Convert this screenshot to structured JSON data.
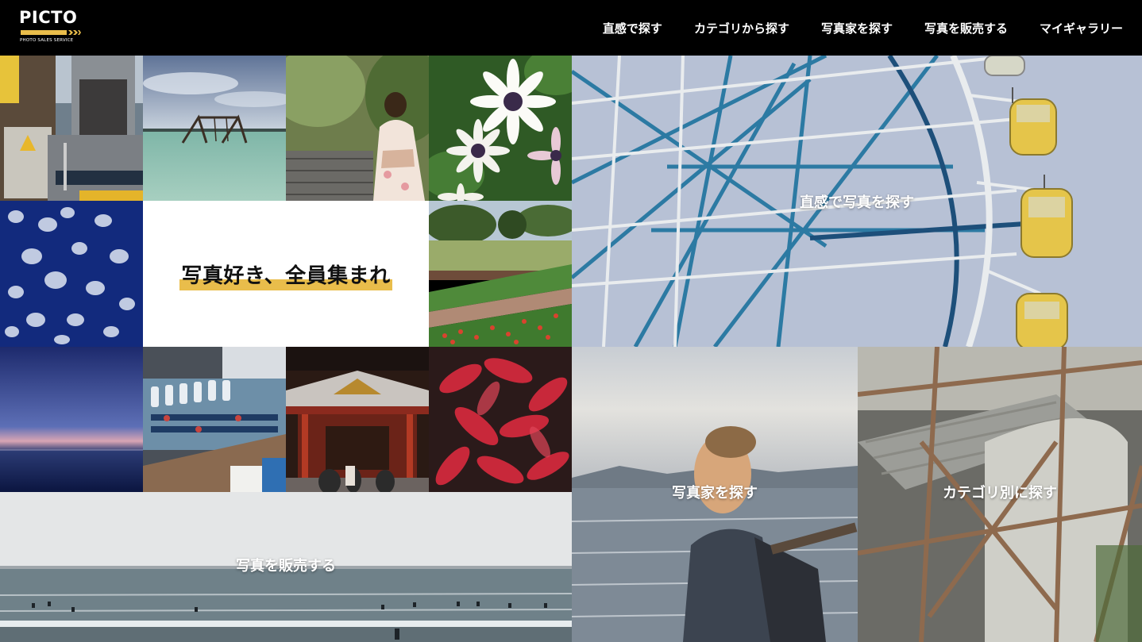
{
  "header": {
    "logo": {
      "word": "PICTO",
      "tagline": "PHOTO SALES SERVICE",
      "accent": "#e9bd4b"
    },
    "nav": [
      {
        "label": "直感で探す"
      },
      {
        "label": "カテゴリから探す"
      },
      {
        "label": "写真家を探す"
      },
      {
        "label": "写真を販売する"
      },
      {
        "label": "マイギャラリー"
      }
    ]
  },
  "hero": {
    "title": "写真好き、全員集まれ",
    "highlight_color": "#e9bd4b"
  },
  "links": {
    "intuition": "直感で写真を探す",
    "photographer": "写真家を探す",
    "category": "カテゴリ別に探す",
    "sell": "写真を販売する"
  },
  "photo_tiles": [
    {
      "subject": "shopping-street-photo"
    },
    {
      "subject": "sea-swing-photo"
    },
    {
      "subject": "kimono-woman-photo"
    },
    {
      "subject": "white-daisy-photo"
    },
    {
      "subject": "jellyfish-photo"
    },
    {
      "subject": "park-flowerbed-photo"
    },
    {
      "subject": "dusk-sea-photo"
    },
    {
      "subject": "drink-cooler-photo"
    },
    {
      "subject": "shrine-gate-photo"
    },
    {
      "subject": "red-leaves-photo"
    }
  ]
}
